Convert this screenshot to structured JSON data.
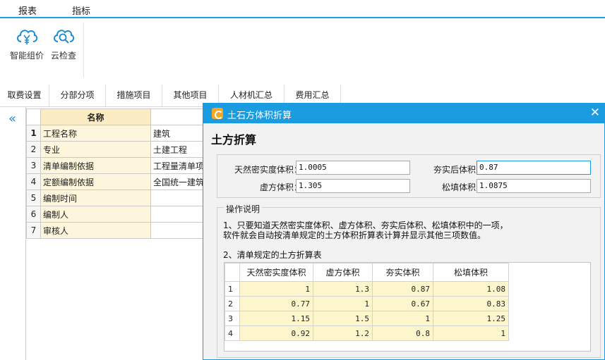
{
  "menu": {
    "items": [
      "报表",
      "指标"
    ]
  },
  "ribbon": {
    "buttons": [
      {
        "label": "智能组价",
        "icon": "cloud-price-icon"
      },
      {
        "label": "云检查",
        "icon": "cloud-search-icon"
      }
    ]
  },
  "tabs": [
    "取费设置",
    "分部分项",
    "措施项目",
    "其他项目",
    "人材机汇总",
    "费用汇总"
  ],
  "collapse_glyph": "«",
  "grid": {
    "header": "名称",
    "rows": [
      {
        "num": "1",
        "name": "工程名称",
        "value": "建筑"
      },
      {
        "num": "2",
        "name": "专业",
        "value": "土建工程"
      },
      {
        "num": "3",
        "name": "清单编制依据",
        "value": "工程量清单项"
      },
      {
        "num": "4",
        "name": "定额编制依据",
        "value": "全国统一建筑"
      },
      {
        "num": "5",
        "name": "编制时间",
        "value": ""
      },
      {
        "num": "6",
        "name": "编制人",
        "value": ""
      },
      {
        "num": "7",
        "name": "审核人",
        "value": ""
      }
    ]
  },
  "dialog": {
    "title": "土石方体积折算",
    "close": "✕",
    "heading": "土方折算",
    "fields": {
      "natural": {
        "label": "天然密实度体积：",
        "value": "1.0005"
      },
      "compacted": {
        "label": "夯实后体积：",
        "value": "0.87"
      },
      "virtual": {
        "label": "虚方体积：",
        "value": "1.305"
      },
      "loose": {
        "label": "松填体积：",
        "value": "1.0875"
      }
    },
    "instructions": {
      "legend": "操作说明",
      "line1": "1、只要知道天然密实度体积、虚方体积、夯实后体积、松填体积中的一项，",
      "line2": "软件就会自动按清单规定的土方体积折算表计算并显示其他三项数值。",
      "line3": "2、清单规定的土方折算表"
    },
    "table": {
      "headers": [
        "天然密实度体积",
        "虚方体积",
        "夯实体积",
        "松填体积"
      ],
      "rows": [
        {
          "num": "1",
          "cells": [
            "1",
            "1.3",
            "0.87",
            "1.08"
          ]
        },
        {
          "num": "2",
          "cells": [
            "0.77",
            "1",
            "0.67",
            "0.83"
          ]
        },
        {
          "num": "3",
          "cells": [
            "1.15",
            "1.5",
            "1",
            "1.25"
          ]
        },
        {
          "num": "4",
          "cells": [
            "0.92",
            "1.2",
            "0.8",
            "1"
          ]
        }
      ]
    }
  },
  "colors": {
    "accent": "#1b9be0",
    "grid_header": "#fbecc4",
    "cell_fill": "#fdf6cc"
  }
}
